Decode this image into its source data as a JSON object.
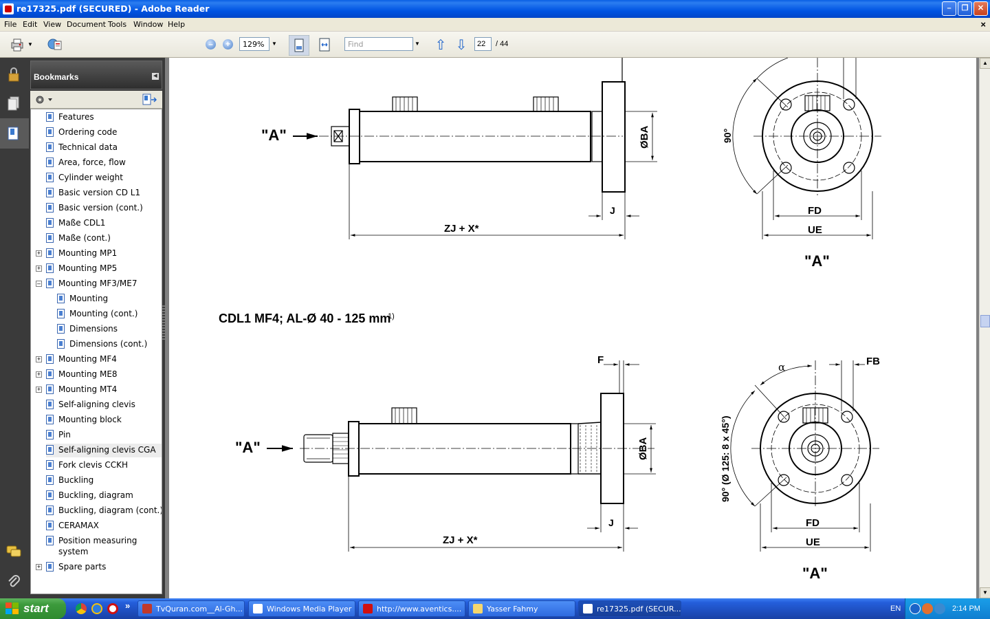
{
  "window": {
    "title": "re17325.pdf (SECURED) - Adobe Reader",
    "minimize": "–",
    "maximize": "❐",
    "close": "✕"
  },
  "menu": [
    "File",
    "Edit",
    "View",
    "Document",
    "Tools",
    "Window",
    "Help"
  ],
  "menu_doc_close": "×",
  "toolbar": {
    "zoom_out": "–",
    "zoom_in": "+",
    "zoom_value": "129%",
    "find_placeholder": "Find",
    "page_current": "22",
    "page_total": "/  44",
    "prev_page": "⇧",
    "next_page": "⇩"
  },
  "bookmarks": {
    "title": "Bookmarks",
    "items": [
      {
        "label": "Features",
        "level": 0,
        "expander": ""
      },
      {
        "label": "Ordering code",
        "level": 0,
        "expander": ""
      },
      {
        "label": "Technical data",
        "level": 0,
        "expander": ""
      },
      {
        "label": "Area, force, flow",
        "level": 0,
        "expander": ""
      },
      {
        "label": "Cylinder weight",
        "level": 0,
        "expander": ""
      },
      {
        "label": "Basic version CD L1",
        "level": 0,
        "expander": ""
      },
      {
        "label": "Basic version (cont.)",
        "level": 0,
        "expander": ""
      },
      {
        "label": "Maße CDL1",
        "level": 0,
        "expander": ""
      },
      {
        "label": "Maße (cont.)",
        "level": 0,
        "expander": ""
      },
      {
        "label": "Mounting MP1",
        "level": 0,
        "expander": "+"
      },
      {
        "label": "Mounting MP5",
        "level": 0,
        "expander": "+"
      },
      {
        "label": "Mounting MF3/ME7",
        "level": 0,
        "expander": "–"
      },
      {
        "label": "Mounting",
        "level": 1,
        "expander": ""
      },
      {
        "label": "Mounting  (cont.)",
        "level": 1,
        "expander": ""
      },
      {
        "label": "Dimensions",
        "level": 1,
        "expander": ""
      },
      {
        "label": "Dimensions (cont.)",
        "level": 1,
        "expander": ""
      },
      {
        "label": "Mounting MF4",
        "level": 0,
        "expander": "+"
      },
      {
        "label": "Mounting ME8",
        "level": 0,
        "expander": "+"
      },
      {
        "label": "Mounting MT4",
        "level": 0,
        "expander": "+"
      },
      {
        "label": "Self-aligning clevis",
        "level": 0,
        "expander": ""
      },
      {
        "label": "Mounting block",
        "level": 0,
        "expander": ""
      },
      {
        "label": "Pin",
        "level": 0,
        "expander": ""
      },
      {
        "label": "Self-aligning clevis CGA",
        "level": 0,
        "expander": "",
        "selected": true
      },
      {
        "label": "Fork clevis CCKH",
        "level": 0,
        "expander": ""
      },
      {
        "label": "Buckling",
        "level": 0,
        "expander": ""
      },
      {
        "label": "Buckling, diagram",
        "level": 0,
        "expander": ""
      },
      {
        "label": "Buckling, diagram (cont.)",
        "level": 0,
        "expander": ""
      },
      {
        "label": "CERAMAX",
        "level": 0,
        "expander": ""
      },
      {
        "label": "Position measuring",
        "level": 0,
        "expander": "",
        "label2": "system"
      },
      {
        "label": "Spare parts",
        "level": 0,
        "expander": "+"
      }
    ]
  },
  "document": {
    "section_heading": "CDL1 MF4; AL-Ø 40 - 125 mm",
    "section_footnote": "1)",
    "top": {
      "view_label": "\"A\"",
      "dim_zj": "ZJ + X*",
      "dim_j": "J",
      "dim_ba": "ØBA",
      "angle": "90°",
      "dim_fd": "FD",
      "dim_ue": "UE",
      "end_view_label": "\"A\""
    },
    "bottom": {
      "view_label": "\"A\"",
      "dim_zj": "ZJ + X*",
      "dim_j": "J",
      "dim_f": "F",
      "dim_ba": "ØBA",
      "angle": "90° (Ø 125: 8 x 45°)",
      "alpha": "α",
      "dim_fb": "FB",
      "dim_fd": "FD",
      "dim_ue": "UE",
      "end_view_label": "\"A\""
    }
  },
  "taskbar": {
    "start": "start",
    "more": "»",
    "tasks": [
      {
        "label": "TvQuran.com__Al-Gh...",
        "color": "#c0392b"
      },
      {
        "label": "Windows Media Player",
        "color": "#ffffff"
      },
      {
        "label": "http://www.aventics....",
        "color": "#d01010"
      },
      {
        "label": "Yasser Fahmy",
        "color": "#f5d76e"
      },
      {
        "label": "re17325.pdf (SECUR...",
        "color": "#ffffff",
        "active": true
      }
    ],
    "lang": "EN",
    "clock": "2:14 PM"
  },
  "colors": {
    "titlebar": "#0054e3",
    "panel_dark": "#3a3a3a",
    "taskbar": "#245edb",
    "start_green": "#3c9a3c"
  }
}
